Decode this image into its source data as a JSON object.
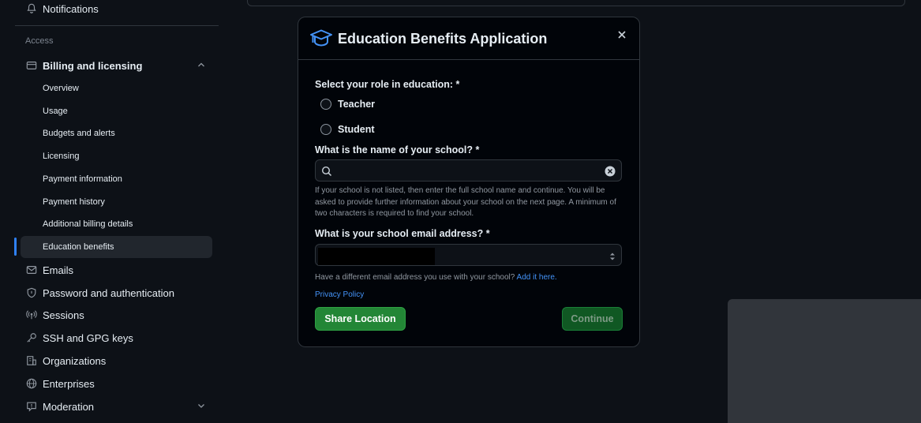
{
  "sidebar": {
    "notifications_label": "Notifications",
    "section_access": "Access",
    "billing_label": "Billing and licensing",
    "billing_items": [
      {
        "label": "Overview"
      },
      {
        "label": "Usage"
      },
      {
        "label": "Budgets and alerts"
      },
      {
        "label": "Licensing"
      },
      {
        "label": "Payment information"
      },
      {
        "label": "Payment history"
      },
      {
        "label": "Additional billing details"
      },
      {
        "label": "Education benefits"
      }
    ],
    "items": [
      {
        "label": "Emails",
        "icon": "mail-icon"
      },
      {
        "label": "Password and authentication",
        "icon": "shield-icon"
      },
      {
        "label": "Sessions",
        "icon": "broadcast-icon"
      },
      {
        "label": "SSH and GPG keys",
        "icon": "key-icon"
      },
      {
        "label": "Organizations",
        "icon": "organization-icon"
      },
      {
        "label": "Enterprises",
        "icon": "globe-icon"
      },
      {
        "label": "Moderation",
        "icon": "report-icon"
      }
    ],
    "active_color": "#2f81f7"
  },
  "modal": {
    "title": "Education Benefits Application",
    "role_label": "Select your role in education: *",
    "roles": [
      {
        "label": "Teacher"
      },
      {
        "label": "Student"
      }
    ],
    "school_label": "What is the name of your school? *",
    "school_value": "",
    "school_help": "If your school is not listed, then enter the full school name and continue. You will be asked to provide further information about your school on the next page. A minimum of two characters is required to find your school.",
    "email_label": "What is your school email address? *",
    "alt_email_text": "Have a different email address you use with your school?",
    "alt_email_link": "Add it here.",
    "privacy_link": "Privacy Policy",
    "share_button": "Share Location",
    "continue_button": "Continue"
  },
  "colors": {
    "background": "#0d1117",
    "modal_bg": "#010409",
    "primary_button": "#238636",
    "link": "#4493f8"
  }
}
